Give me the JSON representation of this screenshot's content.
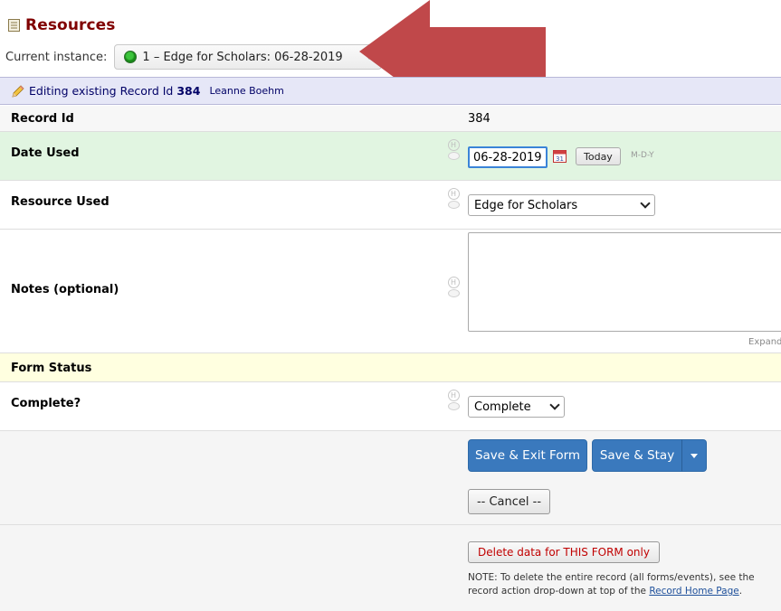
{
  "header": {
    "title": "Resources",
    "instance_label": "Current instance:",
    "instance_value": "1 – Edge for Scholars: 06-28-2019"
  },
  "banner": {
    "editing_text": "Editing existing Record Id",
    "record_id": "384",
    "user": "Leanne Boehm"
  },
  "fields": {
    "record_id": {
      "label": "Record Id",
      "value": "384"
    },
    "date_used": {
      "label": "Date Used",
      "value": "06-28-2019",
      "today": "Today",
      "format": "M-D-Y"
    },
    "resource_used": {
      "label": "Resource Used",
      "selected": "Edge for Scholars"
    },
    "notes": {
      "label": "Notes (optional)",
      "expand": "Expand"
    },
    "form_status": {
      "label": "Form Status"
    },
    "complete": {
      "label": "Complete?",
      "selected": "Complete"
    }
  },
  "actions": {
    "save_exit": "Save & Exit Form",
    "save_stay": "Save & Stay",
    "cancel": "-- Cancel --",
    "delete": "Delete data for THIS FORM only"
  },
  "note": {
    "text": "NOTE: To delete the entire record (all forms/events), see the record action drop-down at top of the",
    "link": "Record Home Page",
    "end": "."
  },
  "colors": {
    "title": "#800000",
    "arrow": "#c0484a",
    "primary_button": "#3a79bd",
    "date_row": "#e1f5e1",
    "status_row": "#ffffe0",
    "banner": "#e6e7f7"
  }
}
